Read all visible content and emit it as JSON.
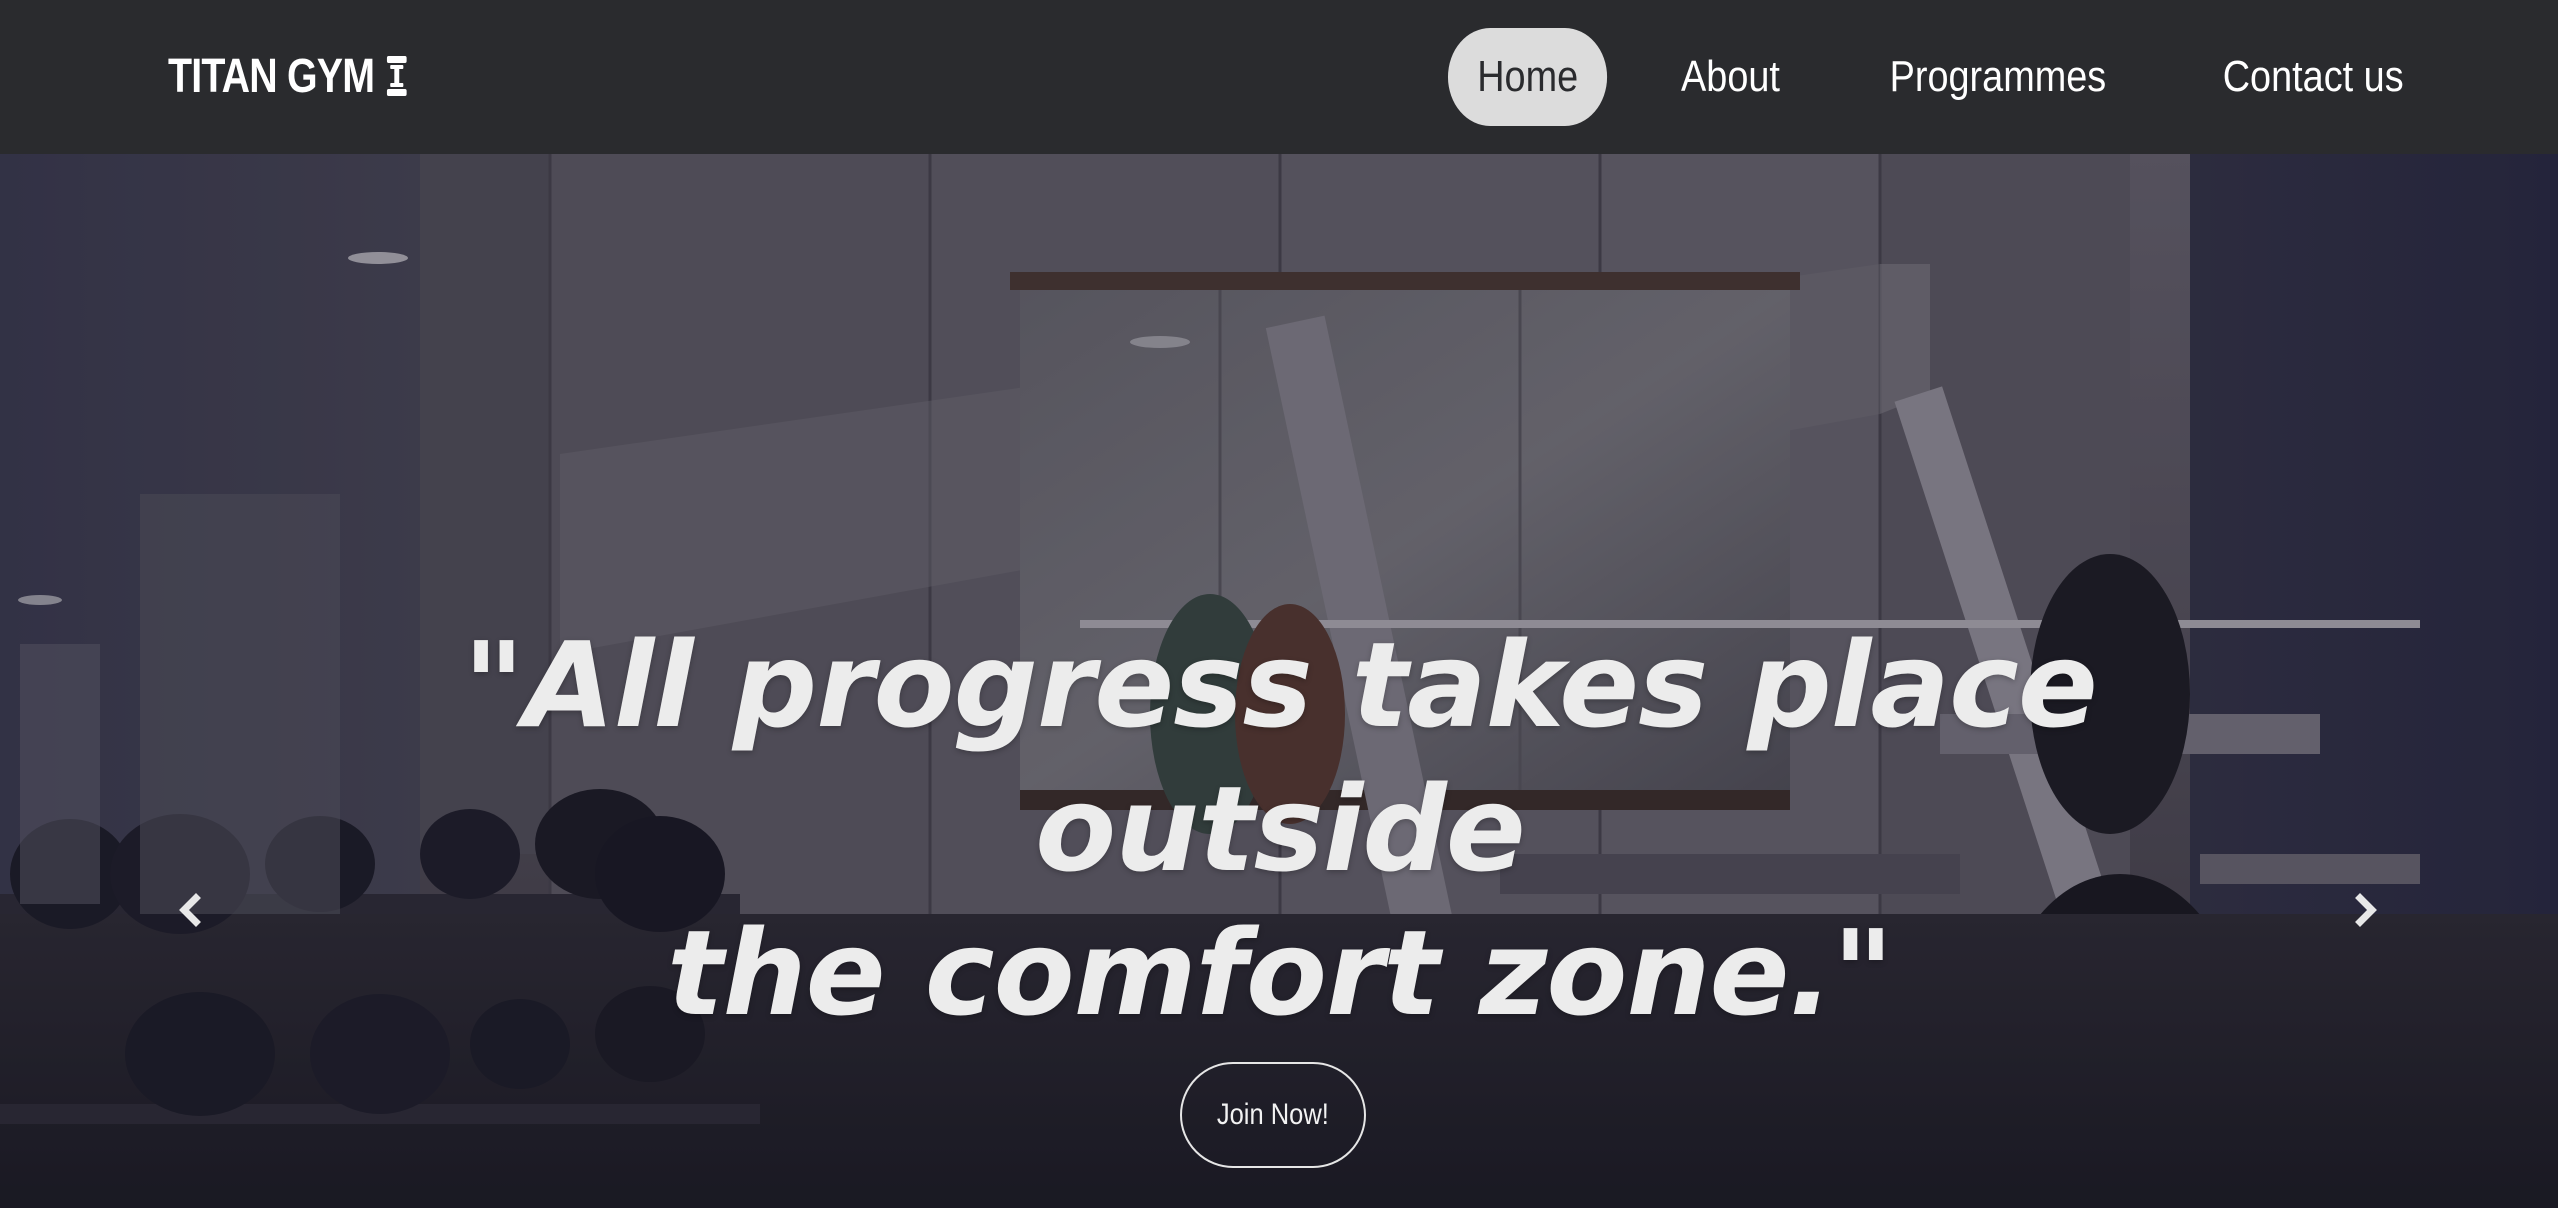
{
  "brand": {
    "name": "TITAN GYM",
    "icon": "dumbbell-icon"
  },
  "nav": {
    "items": [
      {
        "label": "Home",
        "active": true
      },
      {
        "label": "About",
        "active": false
      },
      {
        "label": "Programmes",
        "active": false
      },
      {
        "label": "Contact us",
        "active": false
      }
    ]
  },
  "hero": {
    "quote_line1": "\"All progress takes place outside",
    "quote_line2": "the comfort zone.\"",
    "cta_label": "Join Now!",
    "prev_icon": "chevron-left-icon",
    "next_icon": "chevron-right-icon"
  },
  "colors": {
    "navbar_bg": "#2a2b2e",
    "active_pill_bg": "#dcdcdc",
    "text_light": "#ffffff"
  }
}
